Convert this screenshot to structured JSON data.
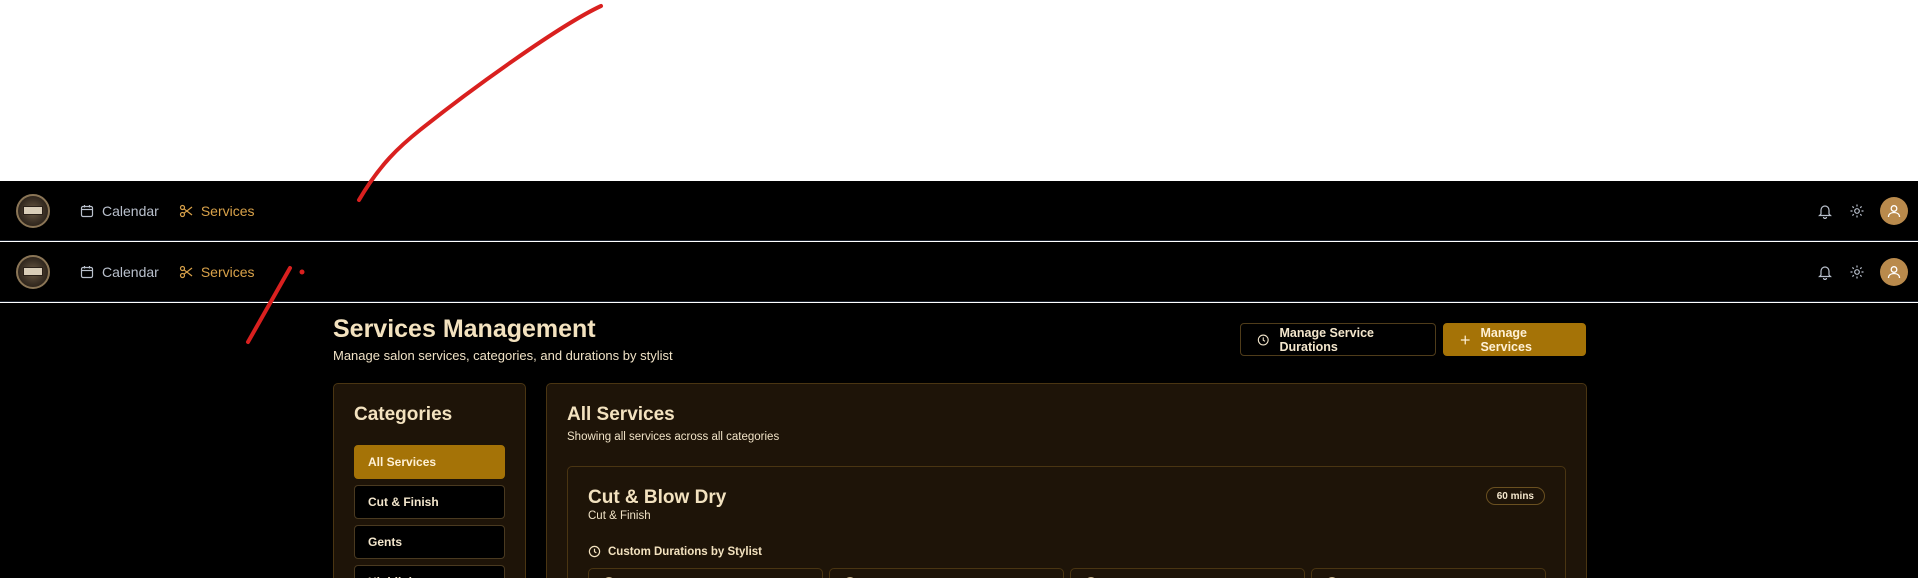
{
  "nav": {
    "links": [
      {
        "label": "Calendar",
        "icon": "calendar-icon",
        "active": false
      },
      {
        "label": "Services",
        "icon": "scissors-icon",
        "active": true
      }
    ],
    "right_icons": [
      "bell-icon",
      "gear-icon",
      "user-avatar-icon"
    ]
  },
  "page": {
    "title": "Services Management",
    "subtitle": "Manage salon services, categories, and durations by stylist",
    "actions": {
      "manage_durations": "Manage Service Durations",
      "manage_services": "Manage Services"
    }
  },
  "categories": {
    "title": "Categories",
    "items": [
      {
        "label": "All Services",
        "active": true
      },
      {
        "label": "Cut & Finish",
        "active": false
      },
      {
        "label": "Gents",
        "active": false
      },
      {
        "label": "Highlights",
        "active": false
      }
    ]
  },
  "services": {
    "title": "All Services",
    "subtitle": "Showing all services across all categories",
    "cards": [
      {
        "name": "Cut & Blow Dry",
        "category": "Cut & Finish",
        "duration": "60 mins",
        "custom_label": "Custom Durations by Stylist"
      }
    ]
  },
  "colors": {
    "accent_gold": "#a57307",
    "panel_bg": "#1e1408",
    "annotation_red": "#d9201f"
  }
}
